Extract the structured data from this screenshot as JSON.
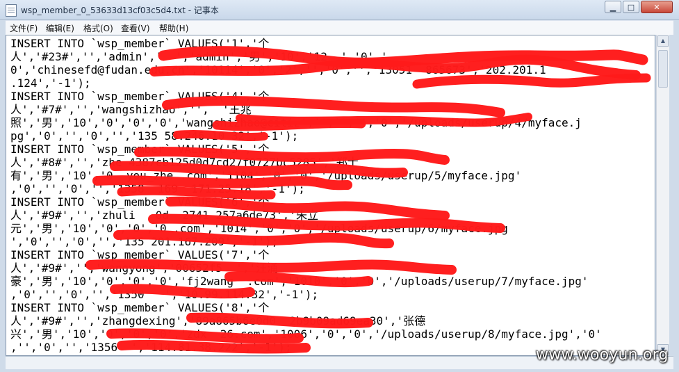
{
  "window": {
    "title": "wsp_member_0_53633d13cf03c5d4.txt - 记事本",
    "minimize_glyph": "▁",
    "maximize_glyph": "□",
    "close_glyph": "✕"
  },
  "menu": [
    "文件(F)",
    "编辑(E)",
    "格式(O)",
    "查看(V)",
    "帮助(H)"
  ],
  "editor_lines": [
    "INSERT INTO `wsp_member` VALUES('1','个",
    "人','#23#','','admin','  ','admin','男','10','12  ','0','",
    "0','chinesefd@fudan.edu.cn','10114','0','2','','0','','13051  865673','202.201.1",
    ".124','-1');",
    "INSERT INTO `wsp_member` VALUES('4','个",
    "人','#7#','','wangshizhao','',  '王兆",
    "照','男','10','0','0','0','wangshizhao@citiz','','','','0','/uploads/userup/4/myface.j",
    "pg','0','','0','','135 58.246.10 32','-1');",
    "INSERT INTO `wsp_member` VALUES('5','个",
    "人','#8#','','zhe 4387cb125d0d7cd27f0727bc5285','郑士",
    "有','男','10','0  you_zhe .com','1104','0','0','/uploads/userup/5/myface.jpg'",
    ",'0','','0','','1358  169  171.25.18','-1');",
    "INSERT INTO `wsp_member` VALUES('6','个",
    "人','#9#','','zhuli   0d  2741 257a6de73','朱立",
    "元','男','10','0','0','0 .com','1014','0','0','/uploads/userup/6/myface.jpg",
    "','0','','0','','135 201.167.209','-1');",
    "INSERT INTO `wsp_member` VALUES('7','个",
    "人','#9#','','wangyong','00652f5  ','汪涌",
    "豪','男','10','0','0','0','fj2wang  .com','1010','0','0','/uploads/userup/7/myface.jpg'",
    ",'0','','0','','1350   ','10.99.114.32','-1');",
    "INSERT INTO `wsp_member` VALUES('8','个",
    "人','#9#','','zhangdexing','89a865b6e0d0  2b9b09ad69ea30','张德",
    "兴','男','10','0','0','0','zdx  26.com','1006','0','0','/uploads/userup/8/myface.jpg','0'",
    ",'','0','','1356  ','114.81.38.222','-1');"
  ],
  "watermark": "www.wooyun.org",
  "colors": {
    "redaction": "#ff1b1b",
    "editor_background": "#ffffff",
    "titlebar": "#c9d8ea"
  },
  "icons": {
    "app": "notepad-icon",
    "scroll_up": "triangle-up",
    "scroll_down": "triangle-down"
  }
}
